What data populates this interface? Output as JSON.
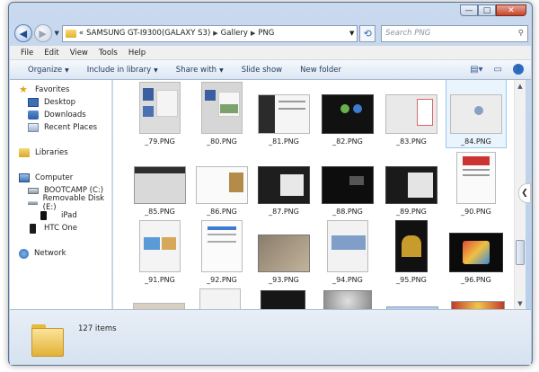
{
  "window": {
    "minimize": "—",
    "maximize": "□",
    "close": "✕"
  },
  "address": {
    "prefix": "«",
    "crumbs": [
      "SAMSUNG GT-I9300(GALAXY S3)",
      "Gallery",
      "PNG"
    ],
    "search_placeholder": "Search PNG"
  },
  "menu": [
    "File",
    "Edit",
    "View",
    "Tools",
    "Help"
  ],
  "toolbar": {
    "organize": "Organize",
    "include": "Include in library",
    "share": "Share with",
    "slideshow": "Slide show",
    "newfolder": "New folder"
  },
  "nav": {
    "favorites": "Favorites",
    "desktop": "Desktop",
    "downloads": "Downloads",
    "recent": "Recent Places",
    "libraries": "Libraries",
    "computer": "Computer",
    "bootcamp": "BOOTCAMP (C:)",
    "removable": "Removable Disk (E:)",
    "ipad": "iPad",
    "htc": "HTC One",
    "network": "Network"
  },
  "files": [
    {
      "name": "_79.PNG"
    },
    {
      "name": "_80.PNG"
    },
    {
      "name": "_81.PNG"
    },
    {
      "name": "_82.PNG"
    },
    {
      "name": "_83.PNG"
    },
    {
      "name": "_84.PNG"
    },
    {
      "name": "_85.PNG"
    },
    {
      "name": "_86.PNG"
    },
    {
      "name": "_87.PNG"
    },
    {
      "name": "_88.PNG"
    },
    {
      "name": "_89.PNG"
    },
    {
      "name": "_90.PNG"
    },
    {
      "name": "_91.PNG"
    },
    {
      "name": "_92.PNG"
    },
    {
      "name": "_93.PNG"
    },
    {
      "name": "_94.PNG"
    },
    {
      "name": "_95.PNG"
    },
    {
      "name": "_96.PNG"
    }
  ],
  "status": {
    "count": "127 items"
  }
}
